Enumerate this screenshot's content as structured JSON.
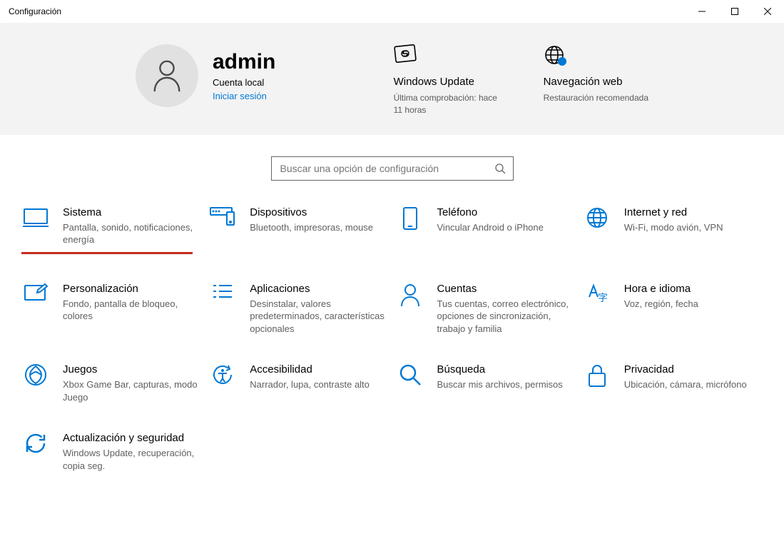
{
  "window_title": "Configuración",
  "account": {
    "name": "admin",
    "type": "Cuenta local",
    "signin": "Iniciar sesión"
  },
  "hero": {
    "update": {
      "title": "Windows Update",
      "desc": "Última comprobación: hace 11 horas"
    },
    "web": {
      "title": "Navegación web",
      "desc": "Restauración recomendada"
    }
  },
  "search": {
    "placeholder": "Buscar una opción de configuración"
  },
  "tiles": {
    "sistema": {
      "title": "Sistema",
      "desc": "Pantalla, sonido, notificaciones, energía"
    },
    "dispositivos": {
      "title": "Dispositivos",
      "desc": "Bluetooth, impresoras, mouse"
    },
    "telefono": {
      "title": "Teléfono",
      "desc": "Vincular Android o iPhone"
    },
    "internet": {
      "title": "Internet y red",
      "desc": "Wi-Fi, modo avión, VPN"
    },
    "personalizacion": {
      "title": "Personalización",
      "desc": "Fondo, pantalla de bloqueo, colores"
    },
    "aplicaciones": {
      "title": "Aplicaciones",
      "desc": "Desinstalar, valores predeterminados, características opcionales"
    },
    "cuentas": {
      "title": "Cuentas",
      "desc": "Tus cuentas, correo electrónico, opciones de sincronización, trabajo y familia"
    },
    "hora": {
      "title": "Hora e idioma",
      "desc": "Voz, región, fecha"
    },
    "juegos": {
      "title": "Juegos",
      "desc": "Xbox Game Bar, capturas, modo Juego"
    },
    "accesibilidad": {
      "title": "Accesibilidad",
      "desc": "Narrador, lupa, contraste alto"
    },
    "busqueda": {
      "title": "Búsqueda",
      "desc": "Buscar mis archivos, permisos"
    },
    "privacidad": {
      "title": "Privacidad",
      "desc": "Ubicación, cámara, micrófono"
    },
    "actualizacion": {
      "title": "Actualización y seguridad",
      "desc": "Windows Update, recuperación, copia seg."
    }
  }
}
